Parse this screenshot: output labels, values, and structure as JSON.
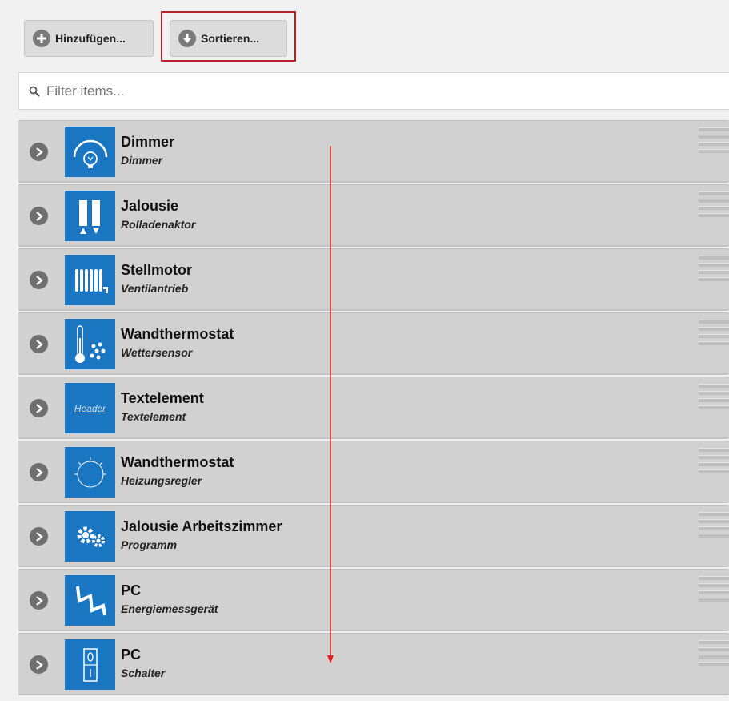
{
  "toolbar": {
    "add_label": "Hinzufügen...",
    "sort_label": "Sortieren..."
  },
  "search": {
    "placeholder": "Filter items..."
  },
  "items": [
    {
      "title": "Dimmer",
      "subtitle": "Dimmer",
      "icon": "dimmer-icon"
    },
    {
      "title": "Jalousie",
      "subtitle": "Rolladenaktor",
      "icon": "shutter-icon"
    },
    {
      "title": "Stellmotor",
      "subtitle": "Ventilantrieb",
      "icon": "radiator-icon"
    },
    {
      "title": "Wandthermostat",
      "subtitle": "Wettersensor",
      "icon": "weather-sensor-icon"
    },
    {
      "title": "Textelement",
      "subtitle": "Textelement",
      "icon": "header-text-icon",
      "icon_text": "Header"
    },
    {
      "title": "Wandthermostat",
      "subtitle": "Heizungsregler",
      "icon": "dial-icon"
    },
    {
      "title": "Jalousie Arbeitszimmer",
      "subtitle": "Programm",
      "icon": "gears-icon"
    },
    {
      "title": "PC",
      "subtitle": "Energiemessgerät",
      "icon": "lightning-icon"
    },
    {
      "title": "PC",
      "subtitle": "Schalter",
      "icon": "switch-icon"
    }
  ],
  "colors": {
    "accent": "#1b76c2",
    "annotation": "#b5202a",
    "row_bg": "#d1d1d1"
  }
}
